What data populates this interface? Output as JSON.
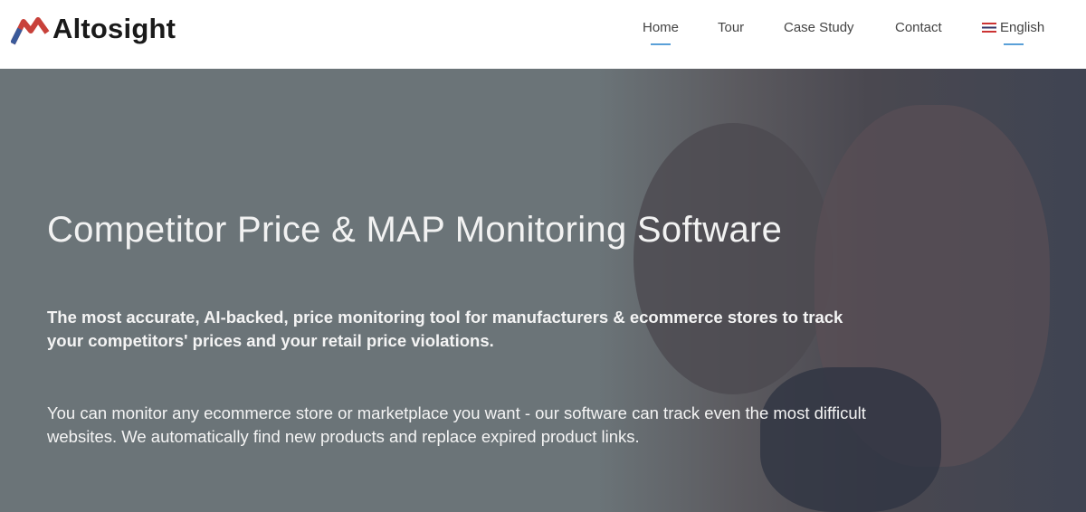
{
  "header": {
    "logo_text": "Altosight",
    "nav": [
      {
        "label": "Home",
        "active": true
      },
      {
        "label": "Tour"
      },
      {
        "label": "Case Study"
      },
      {
        "label": "Contact"
      },
      {
        "label": "English",
        "icon": "uk-flag-icon"
      }
    ]
  },
  "hero": {
    "title": "Competitor Price & MAP Monitoring Software",
    "paragraph1": "The most accurate, AI-backed, price monitoring tool for manufacturers & ecommerce stores to track your competitors' prices and your retail price violations.",
    "paragraph2": "You can monitor any ecommerce store or marketplace you want - our software can track even the most difficult websites. We automatically find new products and replace expired product links."
  }
}
